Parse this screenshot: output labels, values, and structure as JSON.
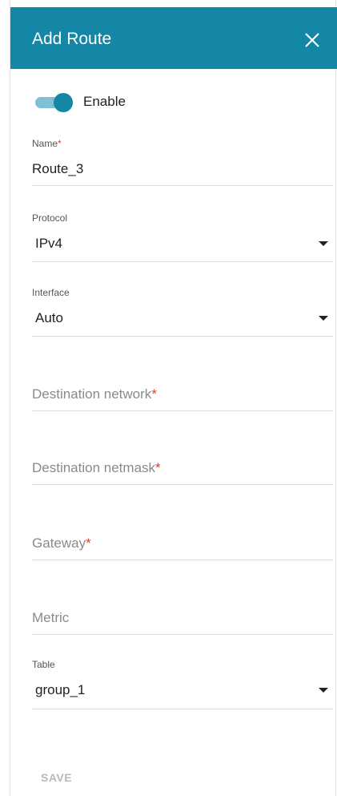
{
  "dialog": {
    "title": "Add Route",
    "close_icon": "close-icon"
  },
  "enable": {
    "label": "Enable",
    "on": true
  },
  "fields": {
    "name": {
      "label": "Name",
      "required_mark": "*",
      "value": "Route_3"
    },
    "protocol": {
      "label": "Protocol",
      "value": "IPv4"
    },
    "interface": {
      "label": "Interface",
      "value": "Auto"
    },
    "destination_network": {
      "placeholder": "Destination network",
      "required_mark": "*"
    },
    "destination_netmask": {
      "placeholder": "Destination netmask",
      "required_mark": "*"
    },
    "gateway": {
      "placeholder": "Gateway",
      "required_mark": "*"
    },
    "metric": {
      "placeholder": "Metric"
    },
    "table": {
      "label": "Table",
      "value": "group_1"
    }
  },
  "actions": {
    "save_label": "SAVE"
  },
  "colors": {
    "accent": "#1487a6",
    "toggle_track": "#7fc1d3",
    "required": "#d9412e",
    "disabled_text": "#b8b8b8"
  }
}
